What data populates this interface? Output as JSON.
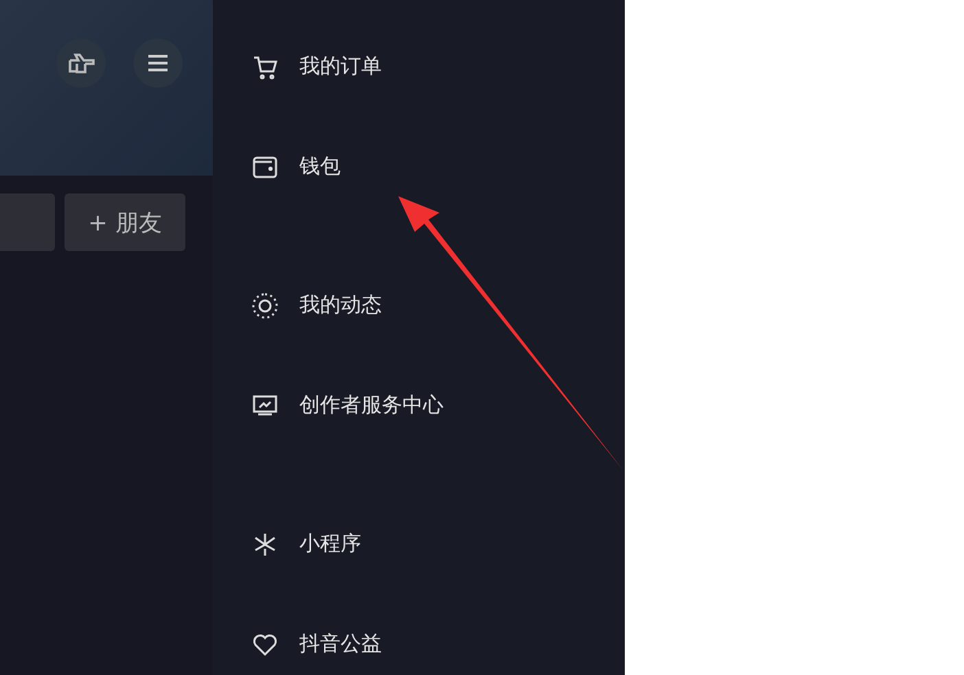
{
  "profile_panel": {
    "buttons": [
      {
        "kind": "blank"
      },
      {
        "kind": "add",
        "label": "+ 朋友"
      }
    ]
  },
  "drawer_menu": {
    "sections": [
      [
        {
          "label": "我的订单"
        },
        {
          "label": "钱包"
        }
      ],
      [
        {
          "label": "我的动态"
        },
        {
          "label": "创作者服务中心"
        }
      ],
      [
        {
          "label": "小程序"
        },
        {
          "label": "抖音公益"
        }
      ]
    ]
  }
}
